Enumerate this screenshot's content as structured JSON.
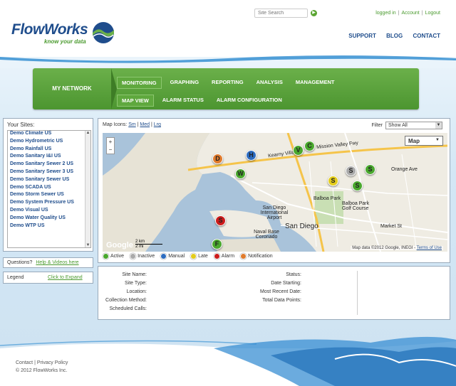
{
  "header": {
    "logo_text": "FlowWorks",
    "logo_tagline": "know your data",
    "search_placeholder": "Site Search",
    "top_links": [
      "logged in",
      "Account",
      "Logout"
    ],
    "main_links": [
      "SUPPORT",
      "BLOG",
      "CONTACT"
    ]
  },
  "nav": {
    "my_network": "MY NETWORK",
    "tabs": [
      "MONITORING",
      "GRAPHING",
      "REPORTING",
      "ANALYSIS",
      "MANAGEMENT"
    ],
    "subtabs": [
      "MAP VIEW",
      "ALARM STATUS",
      "ALARM CONFIGURATION"
    ]
  },
  "sites": {
    "title": "Your Sites:",
    "items": [
      "Demo Climate US",
      "Demo Hydrometric US",
      "Demo Rainfall US",
      "Demo Sanitary I&I US",
      "Demo Sanitary Sewer 2 US",
      "Demo Sanitary Sewer 3 US",
      "Demo Sanitary Sewer US",
      "Demo SCADA US",
      "Demo Storm Sewer US",
      "Demo System Pressure US",
      "Demo Visual US",
      "Demo Water Quality US",
      "Demo WTP US"
    ]
  },
  "questions": {
    "label": "Questions?",
    "link": "Help & Videos here"
  },
  "legend_box": {
    "label": "Legend",
    "link": "Click to Expand"
  },
  "map_panel": {
    "icons_label": "Map Icons:",
    "icon_sizes": [
      "Sm",
      "Med",
      "Lrg"
    ],
    "filter_label": "Filter",
    "filter_value": "Show All",
    "map_type": "Map",
    "google": "Google",
    "scale_km": "2 km",
    "scale_mi": "2 mi",
    "copyright": "Map data ©2012 Google, INEGI -",
    "terms": "Terms of Use",
    "labels": {
      "san_diego": "San Diego",
      "airport": "San Diego International Airport",
      "naval": "Naval Base Coronado",
      "balboa": "Balboa Park",
      "golf": "Balboa Park Golf Course",
      "mission": "Mission Valley Fwy",
      "orange": "Orange Ave",
      "market": "Market St",
      "kearny": "Kearny Villa Rd"
    }
  },
  "markers": [
    {
      "letter": "D",
      "color": "#e07b2c"
    },
    {
      "letter": "H",
      "color": "#2d6cc0"
    },
    {
      "letter": "W",
      "color": "#4aa82e"
    },
    {
      "letter": "V",
      "color": "#4aa82e"
    },
    {
      "letter": "C",
      "color": "#4aa82e"
    },
    {
      "letter": "S",
      "color": "#aaaaaa"
    },
    {
      "letter": "S",
      "color": "#4aa82e"
    },
    {
      "letter": "S",
      "color": "#e3cc1c"
    },
    {
      "letter": "S",
      "color": "#4aa82e"
    },
    {
      "letter": "S",
      "color": "#cc1c1c"
    },
    {
      "letter": "F",
      "color": "#4aa82e"
    }
  ],
  "legend": [
    {
      "label": "Active",
      "color": "#4aa82e"
    },
    {
      "label": "Inactive",
      "color": "#aaaaaa"
    },
    {
      "label": "Manual",
      "color": "#2d6cc0"
    },
    {
      "label": "Late",
      "color": "#e3cc1c"
    },
    {
      "label": "Alarm",
      "color": "#cc1c1c"
    },
    {
      "label": "Notification",
      "color": "#e07b2c"
    }
  ],
  "info": {
    "left": [
      "Site Name:",
      "Site Type:",
      "Location:",
      "Collection Method:",
      "Scheduled Calls:"
    ],
    "right": [
      "Status:",
      "Date Starting:",
      "Most Recent Date:",
      "Total Data Points:"
    ]
  },
  "footer": {
    "contact": "Contact",
    "privacy": "Privacy Policy",
    "copyright": "© 2012 FlowWorks Inc."
  }
}
